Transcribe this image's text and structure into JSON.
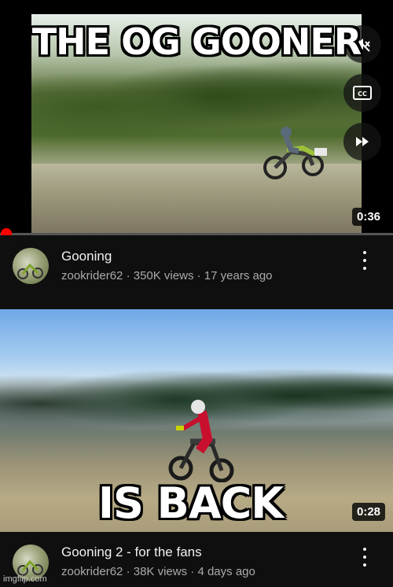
{
  "meme": {
    "top_text": "THE OG GOONER",
    "bottom_text": "IS BACK"
  },
  "video1": {
    "duration": "0:36",
    "title": "Gooning",
    "channel": "zookrider62",
    "views": "350K views",
    "age": "17 years ago",
    "progress_fraction": 0.0,
    "controls": [
      "mute-icon",
      "cc-icon",
      "skip-next-icon"
    ]
  },
  "video2": {
    "duration": "0:28",
    "title": "Gooning 2 - for the fans",
    "channel": "zookrider62",
    "views": "38K views",
    "age": "4 days ago"
  },
  "separator": "·",
  "watermark": "imgflip.com",
  "colors": {
    "background": "#0f0f0f",
    "progress": "#ff0000",
    "subtext": "#aaaaaa"
  }
}
